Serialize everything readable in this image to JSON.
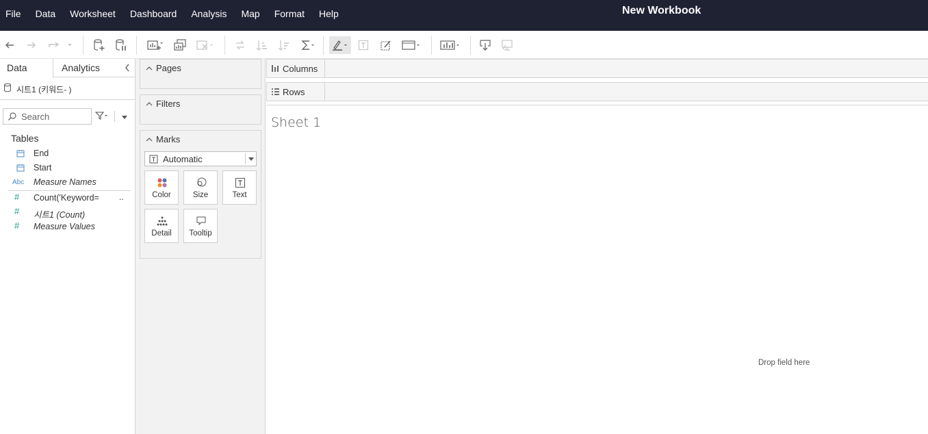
{
  "menubar": {
    "items": [
      "File",
      "Data",
      "Worksheet",
      "Dashboard",
      "Analysis",
      "Map",
      "Format",
      "Help"
    ],
    "title": "New Workbook"
  },
  "datapane": {
    "tabs": {
      "data": "Data",
      "analytics": "Analytics"
    },
    "datasource": "시트1 (키워드-          )",
    "search_placeholder": "Search",
    "tables_header": "Tables",
    "dimensions": [
      {
        "icon": "calendar-icon",
        "label": "End",
        "italic": false
      },
      {
        "icon": "calendar-icon",
        "label": "Start",
        "italic": false
      },
      {
        "icon": "abc-icon",
        "icon_text": "Abc",
        "label": "Measure Names",
        "italic": true
      }
    ],
    "measures": [
      {
        "icon": "hash-icon",
        "label": "Count('Keyword=",
        "more": "..",
        "italic": false
      },
      {
        "icon": "hash-icon",
        "label": "시트1 (Count)",
        "italic": true
      },
      {
        "icon": "hash-icon",
        "label": "Measure Values",
        "italic": true
      }
    ],
    "measure_icon_text": "#"
  },
  "shelves": {
    "pages": "Pages",
    "filters": "Filters",
    "marks": "Marks",
    "mark_type": "Automatic",
    "mark_buttons": {
      "color": "Color",
      "size": "Size",
      "text": "Text",
      "detail": "Detail",
      "tooltip": "Tooltip"
    }
  },
  "view": {
    "columns_label": "Columns",
    "rows_label": "Rows",
    "sheet_title": "Sheet 1",
    "drop_hint": "Drop field here"
  },
  "colors": {
    "menubar_bg": "#1f2233",
    "dimension_icon": "#4a8ec9",
    "measure_icon": "#1f9c8a"
  }
}
